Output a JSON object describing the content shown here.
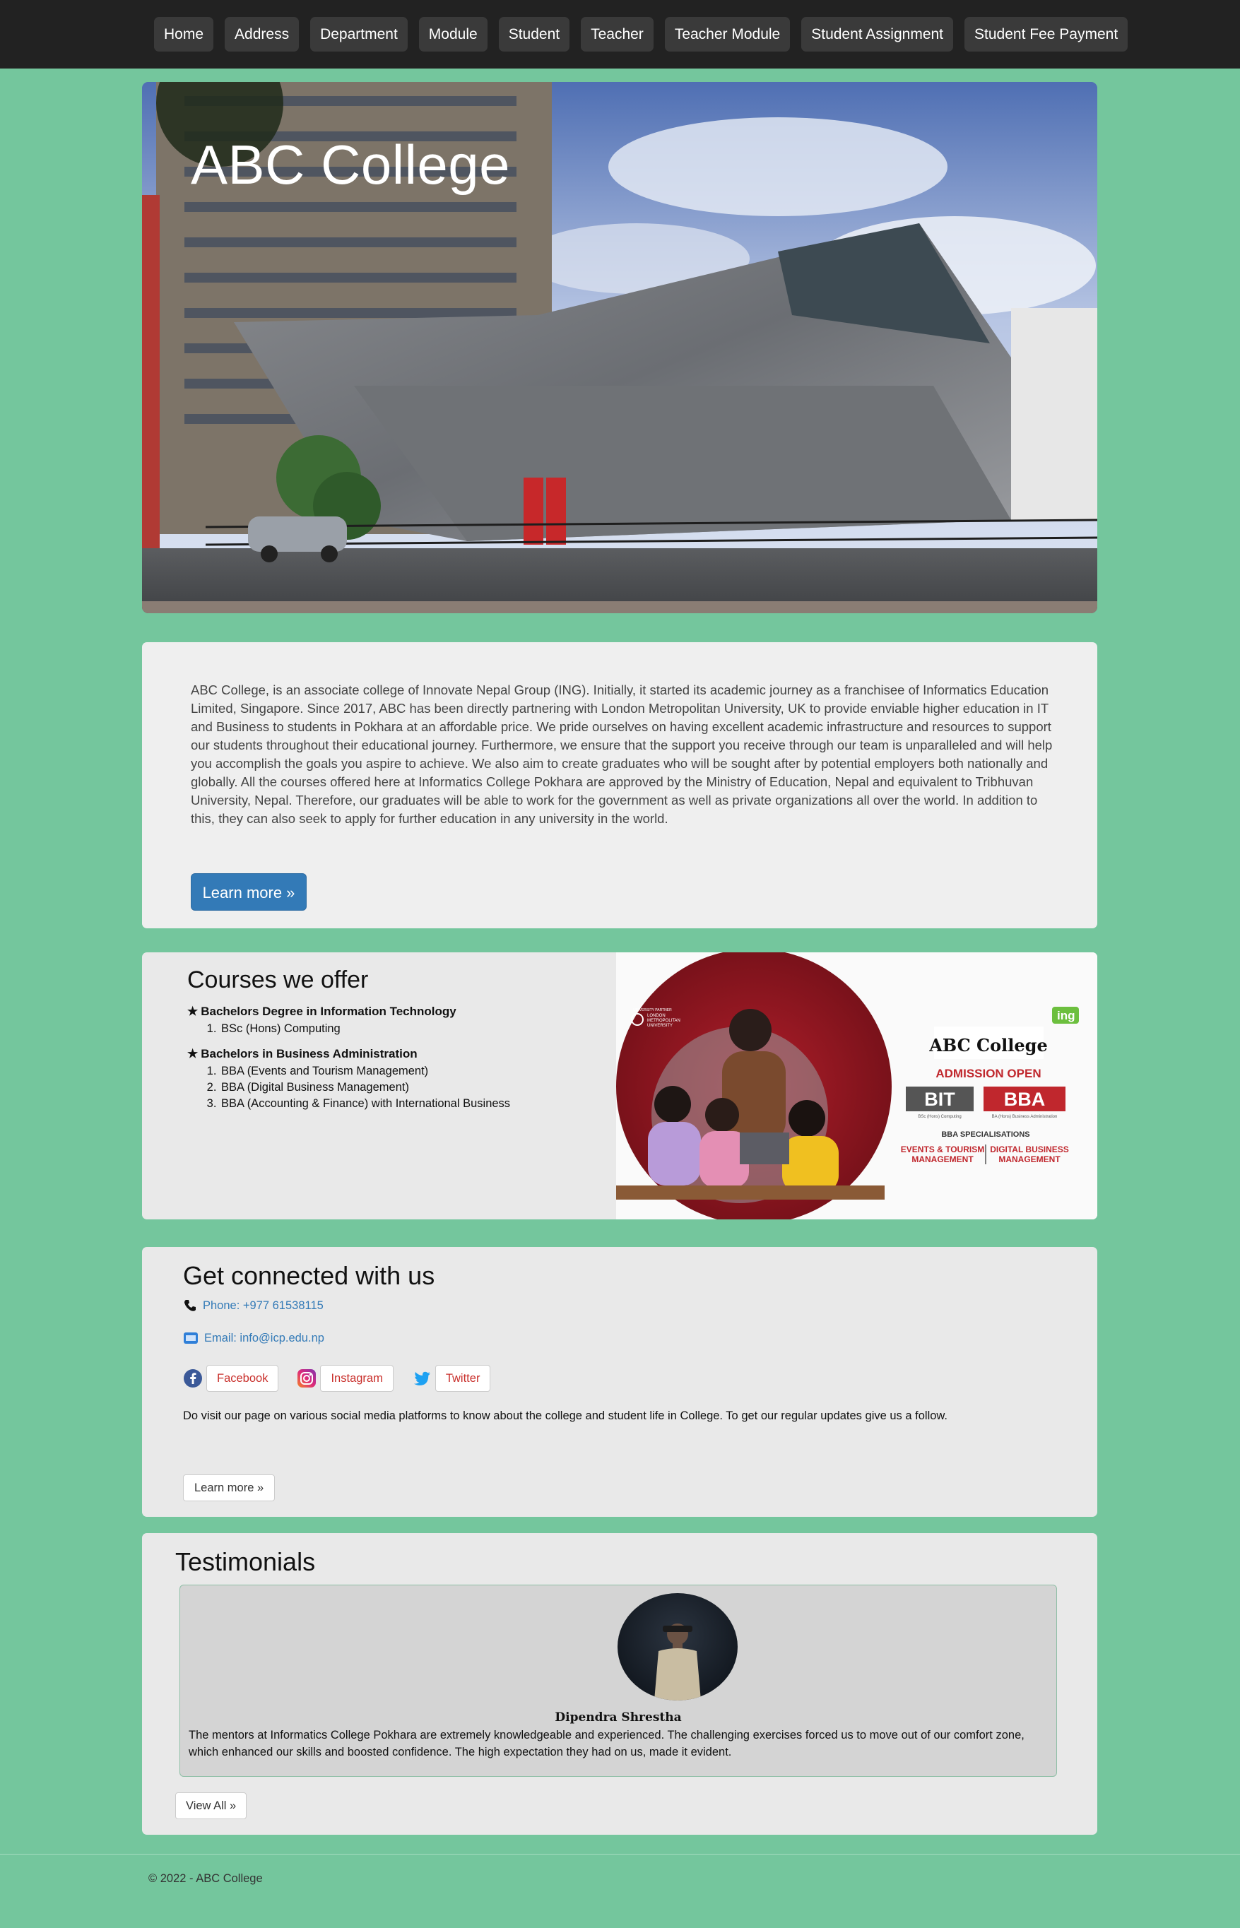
{
  "nav": {
    "items": [
      {
        "label": "Home"
      },
      {
        "label": "Address"
      },
      {
        "label": "Department"
      },
      {
        "label": "Module"
      },
      {
        "label": "Student"
      },
      {
        "label": "Teacher"
      },
      {
        "label": "Teacher Module"
      },
      {
        "label": "Student Assignment"
      },
      {
        "label": "Student Fee Payment"
      }
    ]
  },
  "hero": {
    "title": "ABC College"
  },
  "about": {
    "text": "ABC College, is an associate college of Innovate Nepal Group (ING). Initially, it started its academic journey as a franchisee of Informatics Education Limited, Singapore. Since 2017, ABC has been directly partnering with London Metropolitan University, UK to provide enviable higher education in IT and Business to students in Pokhara at an affordable price. We pride ourselves on having excellent academic infrastructure and resources to support our students throughout their educational journey. Furthermore, we ensure that the support you receive through our team is unparalleled and will help you accomplish the goals you aspire to achieve. We also aim to create graduates who will be sought after by potential employers both nationally and globally. All the courses offered here at Informatics College Pokhara are approved by the Ministry of Education, Nepal and equivalent to Tribhuvan University, Nepal. Therefore, our graduates will be able to work for the government as well as private organizations all over the world. In addition to this, they can also seek to apply for further education in any university in the world.",
    "button_label": "Learn more »"
  },
  "courses": {
    "title": "Courses we offer",
    "groups": [
      {
        "star": "★",
        "heading": "Bachelors Degree in Information Technology",
        "items": [
          "BSc (Hons) Computing"
        ]
      },
      {
        "star": "★",
        "heading": "Bachelors in Business Administration",
        "items": [
          "BBA (Events and Tourism Management)",
          "BBA (Digital Business Management)",
          "BBA (Accounting & Finance) with International Business"
        ]
      }
    ],
    "promo": {
      "uni_line1": "UNIVERSITY PARTNER",
      "uni_line2": "LONDON",
      "uni_line3": "METROPOLITAN",
      "uni_line4": "UNIVERSITY",
      "ing_badge": "ing",
      "college": "ABC College",
      "admission": "ADMISSION OPEN",
      "bit": "BIT",
      "bit_sub": "BSc (Hons) Computing",
      "bba": "BBA",
      "bba_sub": "BA (Hons) Business Administration",
      "spec_title": "BBA SPECIALISATIONS",
      "spec1_line1": "EVENTS & TOURISM",
      "spec1_line2": "MANAGEMENT",
      "spec2_line1": "DIGITAL BUSINESS",
      "spec2_line2": "MANAGEMENT",
      "accent": "#c0272d"
    }
  },
  "connect": {
    "title": "Get connected with us",
    "phone": "Phone: +977 61538115",
    "email": "Email: info@icp.edu.np",
    "social": [
      {
        "label": "Facebook",
        "icon": "facebook-icon"
      },
      {
        "label": "Instagram",
        "icon": "instagram-icon"
      },
      {
        "label": "Twitter",
        "icon": "twitter-icon"
      }
    ],
    "note": "Do visit our page on various social media platforms to know about the college and student life in College. To get our regular updates give us a follow.",
    "button_label": "Learn more »"
  },
  "testimonials": {
    "title": "Testimonials",
    "items": [
      {
        "name": "Dipendra Shrestha",
        "quote": "The mentors at Informatics College Pokhara are extremely knowledgeable and experienced. The challenging exercises forced us to move out of our comfort zone, which enhanced our skills and boosted confidence. The high expectation they had on us, made it evident."
      }
    ],
    "button_label": "View All »"
  },
  "footer": {
    "text": "© 2022 - ABC College"
  },
  "colors": {
    "page_bg": "#74c69d",
    "navbar_bg": "#222222",
    "primary": "#337ab7",
    "link_red": "#c9302c"
  }
}
